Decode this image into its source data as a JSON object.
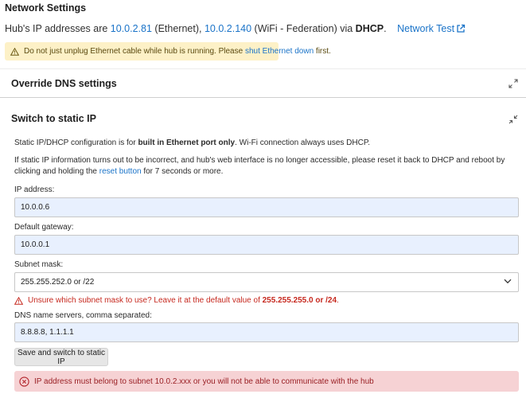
{
  "header": {
    "title": "Network Settings",
    "ip_intro": "Hub's IP addresses are",
    "eth_ip": "10.0.2.81",
    "eth_label": "(Ethernet),",
    "wifi_ip": "10.0.2.140",
    "wifi_label": "(WiFi - Federation) via",
    "mode": "DHCP",
    "period": ".",
    "network_test": "Network Test"
  },
  "warning": {
    "before": "Do not just unplug Ethernet cable while hub is running. Please",
    "link": "shut Ethernet down",
    "after": "first."
  },
  "dns_panel": {
    "title": "Override DNS settings"
  },
  "static_panel": {
    "title": "Switch to static IP",
    "note1_a": "Static IP/DHCP configuration is for",
    "note1_b": "built in Ethernet port only",
    "note1_c": ". Wi-Fi connection always uses DHCP.",
    "note2_a": "If static IP information turns out to be incorrect, and hub's web interface is no longer accessible, please reset it back to DHCP and reboot by clicking and holding the",
    "note2_link": "reset button",
    "note2_b": "for 7 seconds or more.",
    "ip_label": "IP address:",
    "ip_value": "10.0.0.6",
    "gw_label": "Default gateway:",
    "gw_value": "10.0.0.1",
    "mask_label": "Subnet mask:",
    "mask_value": "255.255.252.0 or /22",
    "mask_hint_a": "Unsure which subnet mask to use? Leave it at the default value of",
    "mask_hint_b": "255.255.255.0 or /24",
    "mask_hint_c": ".",
    "dns_label": "DNS name servers, comma separated:",
    "dns_value": "8.8.8.8, 1.1.1.1",
    "save_label": "Save and switch to static IP",
    "error": "IP address must belong to subnet 10.0.2.xxx or you will not be able to communicate with the hub"
  },
  "icons": {
    "warning": "warning-triangle-icon",
    "external": "external-link-icon",
    "expand": "expand-icon",
    "collapse": "collapse-icon",
    "dropdown": "chevron-down-icon",
    "error": "error-circle-x-icon"
  },
  "colors": {
    "link": "#1a73c8",
    "warning_bg": "#fdf1c7",
    "error_bg": "#f6d2d4",
    "error_text": "#c6281e",
    "field_bg": "#e8f0fe"
  }
}
